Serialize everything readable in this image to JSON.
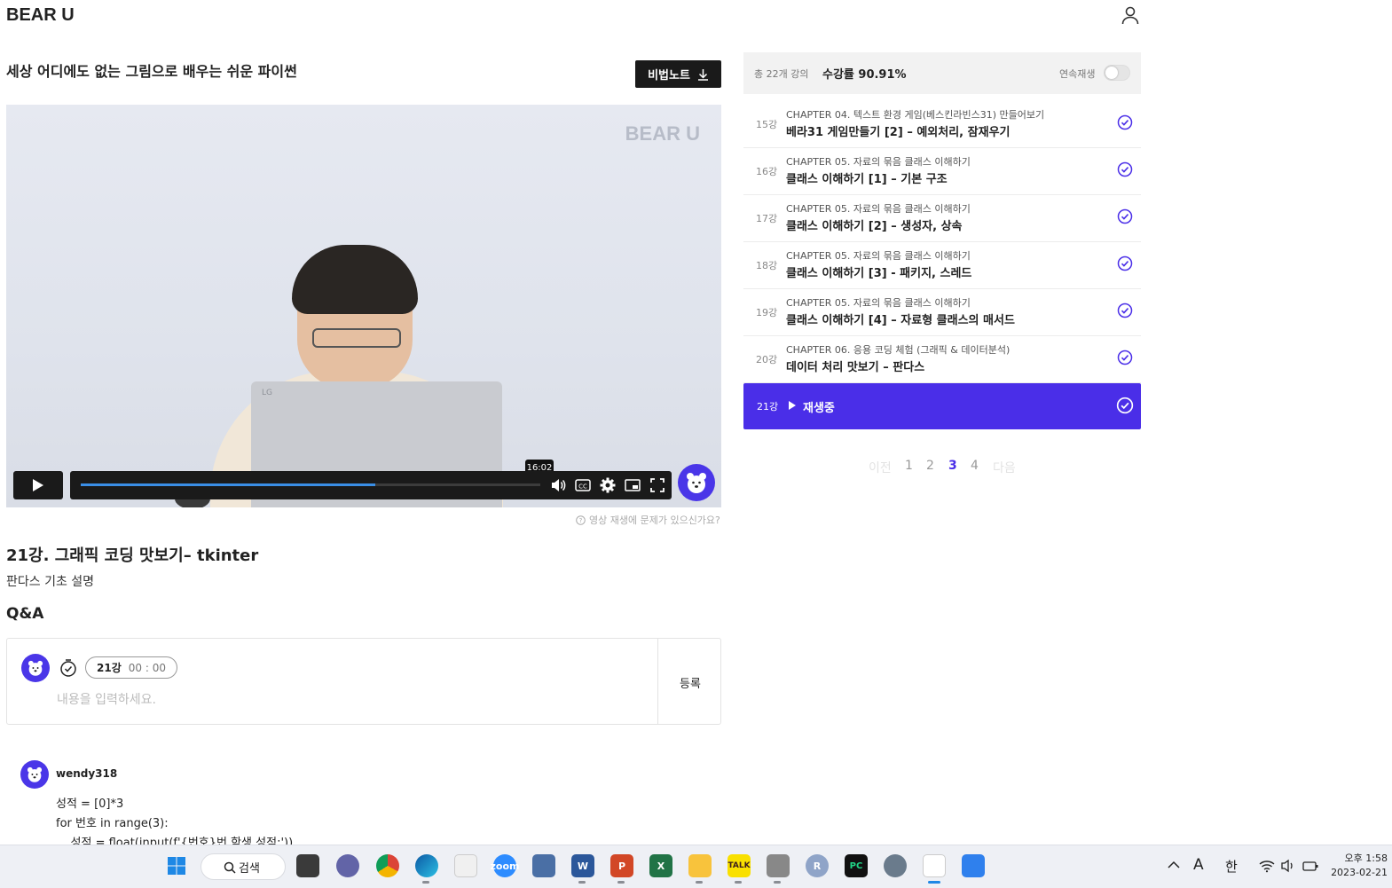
{
  "header": {
    "logo": "BEAR U"
  },
  "course": {
    "title": "세상 어디에도 없는 그림으로 배우는 쉬운 파이썬",
    "secret_note_label": "비법노트"
  },
  "video": {
    "watermark": "BEAR U",
    "laptop_brand": "LG",
    "time_tooltip": "16:02",
    "progress": 0.64,
    "report_link": "영상 재생에 문제가 있으신가요?"
  },
  "lecture": {
    "title": "21강. 그래픽 코딩 맛보기– tkinter",
    "subtitle": "판다스 기초 설명"
  },
  "qa": {
    "title": "Q&A",
    "lecture_tag": "21강",
    "time": "00 : 00",
    "placeholder": "내용을 입력하세요.",
    "submit_label": "등록"
  },
  "comment": {
    "user": "wendy318",
    "lines": [
      "성적 = [0]*3",
      "for 번호 in range(3):",
      "    성적 = float(input(f'{번호}번 학생 성적:'))"
    ]
  },
  "sidebar": {
    "total": "총 22개 강의",
    "rate": "수강률 90.91%",
    "continuous": "연속재생",
    "lessons": [
      {
        "num": "15강",
        "chapter": "CHAPTER 04. 텍스트 환경 게임(베스킨라빈스31) 만들어보기",
        "name": "베라31 게임만들기 [2] – 예외처리, 잠재우기"
      },
      {
        "num": "16강",
        "chapter": "CHAPTER 05. 자료의 묶음 클래스 이해하기",
        "name": "클래스 이해하기 [1] – 기본 구조"
      },
      {
        "num": "17강",
        "chapter": "CHAPTER 05. 자료의 묶음 클래스 이해하기",
        "name": "클래스 이해하기 [2] – 생성자, 상속"
      },
      {
        "num": "18강",
        "chapter": "CHAPTER 05. 자료의 묶음 클래스 이해하기",
        "name": "클래스 이해하기 [3] - 패키지, 스레드"
      },
      {
        "num": "19강",
        "chapter": "CHAPTER 05. 자료의 묶음 클래스 이해하기",
        "name": "클래스 이해하기 [4] – 자료형 클래스의 매서드"
      },
      {
        "num": "20강",
        "chapter": "CHAPTER 06. 응용 코딩 체험 (그래픽 & 데이터분석)",
        "name": "데이터 처리 맛보기 – 판다스"
      }
    ],
    "active": {
      "num": "21강",
      "label": "재생중"
    }
  },
  "pager": {
    "prev": "이전",
    "pages": [
      "1",
      "2",
      "3",
      "4"
    ],
    "current": "3",
    "next": "다음"
  },
  "taskbar": {
    "search_label": "검색",
    "ime_a": "A",
    "ime_ko": "한",
    "time": "오후 1:58",
    "date": "2023-02-21"
  },
  "colors": {
    "accent": "#4a2ee8",
    "dark_button": "#1a1a1a"
  }
}
